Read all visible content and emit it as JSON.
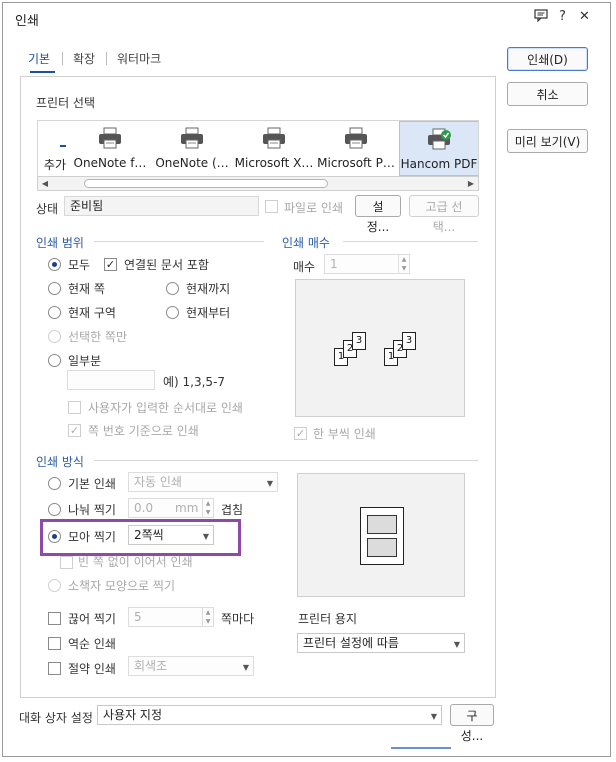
{
  "window": {
    "title": "인쇄"
  },
  "titlebar_icons": {
    "chat": "comment-icon",
    "help": "?",
    "close": "✕"
  },
  "tabs": [
    {
      "label": "기본"
    },
    {
      "label": "확장"
    },
    {
      "label": "워터마크"
    }
  ],
  "side_buttons": {
    "print": "인쇄(D)",
    "cancel": "취소",
    "preview": "미리 보기(V)"
  },
  "printer_select": {
    "title": "프린터 선택",
    "printers": [
      {
        "name": "추가"
      },
      {
        "name": "OneNote f…"
      },
      {
        "name": "OneNote (…"
      },
      {
        "name": "Microsoft X…"
      },
      {
        "name": "Microsoft P…"
      },
      {
        "name": "Hancom PDF"
      }
    ]
  },
  "status": {
    "label": "상태",
    "value": "준비됨",
    "file_print": "파일로 인쇄",
    "settings_button": "설정...",
    "advanced_button": "고급 선택..."
  },
  "range": {
    "title": "인쇄 범위",
    "all": "모두",
    "include_linked": "연결된 문서 포함",
    "current_page": "현재 쪽",
    "until_current": "현재까지",
    "current_section": "현재 구역",
    "from_current": "현재부터",
    "selected_page": "선택한 쪽만",
    "partial": "일부분",
    "example": "예) 1,3,5-7",
    "user_order": "사용자가 입력한 순서대로 인쇄",
    "by_page_number": "쪽 번호 기준으로 인쇄"
  },
  "copies": {
    "title": "인쇄 매수",
    "label": "매수",
    "value": "1",
    "collate": "한 부씩 인쇄",
    "page_labels": [
      "1",
      "2",
      "3"
    ]
  },
  "method": {
    "title": "인쇄 방식",
    "basic": "기본 인쇄",
    "basic_value": "자동 인쇄",
    "split": "나눠 찍기",
    "split_value": "0.0",
    "split_unit": "mm",
    "overlap": "겹침",
    "collect": "모아 찍기",
    "collect_value": "2쪽씩",
    "no_blank": "빈 쪽 없이 이어서 인쇄",
    "booklet": "소책자 모양으로 찍기",
    "cut": "끊어 찍기",
    "cut_value": "5",
    "cut_suffix": "쪽마다",
    "reverse": "역순 인쇄",
    "saving": "절약 인쇄",
    "saving_value": "회색조"
  },
  "paper": {
    "title": "프린터 용지",
    "value": "프린터 설정에 따름"
  },
  "dialog_settings": {
    "label": "대화 상자 설정",
    "value": "사용자 지정",
    "config_button": "구성..."
  },
  "colors": {
    "accent": "#1e4fa5",
    "highlight": "#8e4aa6",
    "selected_printer": "#dbe7f7"
  }
}
